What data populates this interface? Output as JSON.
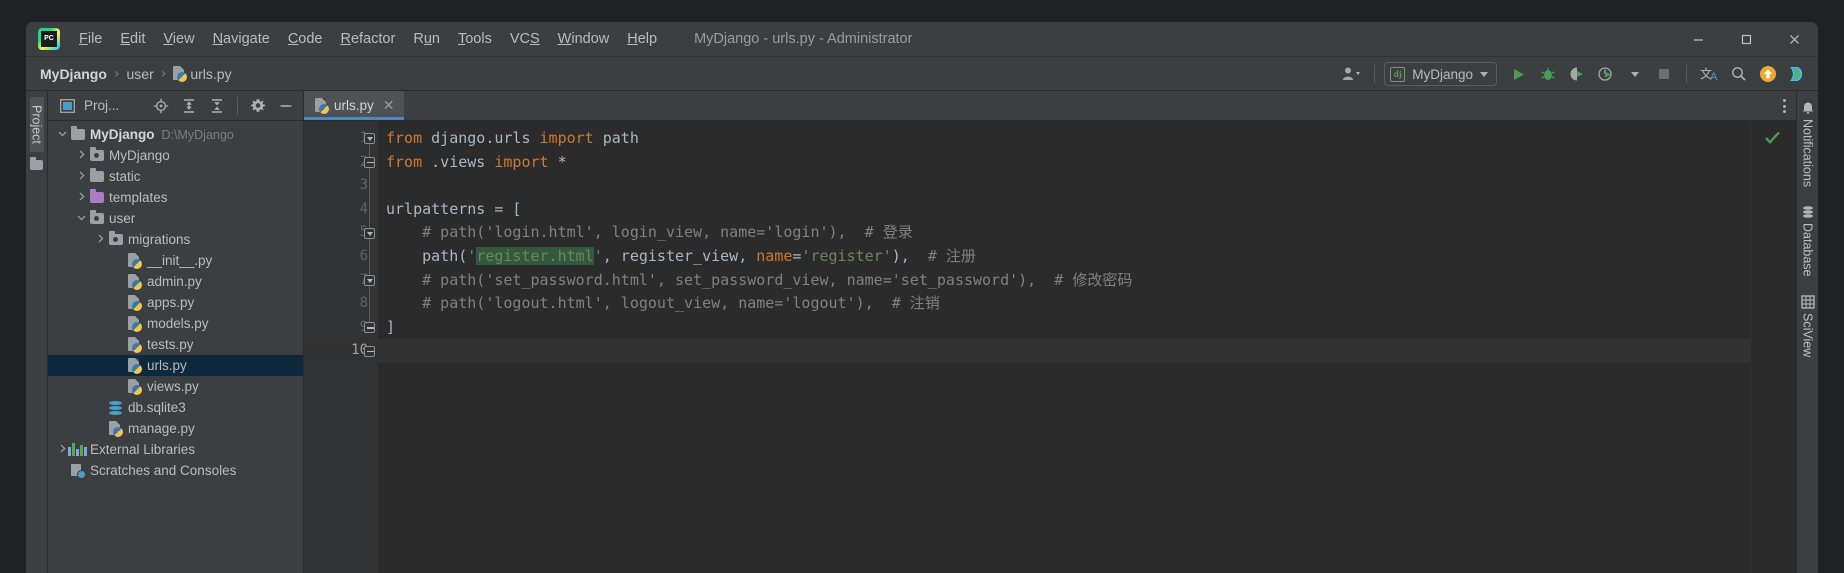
{
  "window": {
    "title": "MyDjango - urls.py - Administrator",
    "logo": "pycharm-logo",
    "minimize": "—",
    "maximize": "☐",
    "close": "✕"
  },
  "menu": {
    "items": [
      {
        "label": "File",
        "mnemonic": "F"
      },
      {
        "label": "Edit",
        "mnemonic": "E"
      },
      {
        "label": "View",
        "mnemonic": "V"
      },
      {
        "label": "Navigate",
        "mnemonic": "N"
      },
      {
        "label": "Code",
        "mnemonic": "C"
      },
      {
        "label": "Refactor",
        "mnemonic": "R"
      },
      {
        "label": "Run",
        "mnemonic": "u"
      },
      {
        "label": "Tools",
        "mnemonic": "T"
      },
      {
        "label": "VCS",
        "mnemonic": "S"
      },
      {
        "label": "Window",
        "mnemonic": "W"
      },
      {
        "label": "Help",
        "mnemonic": "H"
      }
    ]
  },
  "breadcrumb": {
    "items": [
      "MyDjango",
      "user",
      "urls.py"
    ],
    "separator": "›"
  },
  "toolbar": {
    "run_config": "MyDjango",
    "run_config_icon": "django-icon",
    "buttons": [
      {
        "name": "run-button",
        "icon": "play-icon"
      },
      {
        "name": "debug-button",
        "icon": "bug-icon"
      },
      {
        "name": "run-coverage-button",
        "icon": "coverage-icon"
      },
      {
        "name": "profile-button",
        "icon": "profiler-icon"
      },
      {
        "name": "stop-button",
        "icon": "stop-icon"
      },
      {
        "name": "translate-button",
        "icon": "translate-icon"
      },
      {
        "name": "search-everywhere-button",
        "icon": "search-icon"
      },
      {
        "name": "update-project-button",
        "icon": "arrow-up-icon"
      },
      {
        "name": "datalore-button",
        "icon": "datalore-icon"
      }
    ],
    "translate_glyph": "文A"
  },
  "left_rail": {
    "label": "Project"
  },
  "project_panel": {
    "title": "Proj...",
    "actions": [
      "locate-icon",
      "expand-all-icon",
      "collapse-all-icon",
      "settings-icon",
      "hide-icon"
    ],
    "tree": [
      {
        "label": "MyDjango",
        "sub": "D:\\MyDjango",
        "depth": 0,
        "arrow": "down",
        "icon": "folder-gray",
        "bold": true,
        "selected": false
      },
      {
        "label": "MyDjango",
        "sub": "",
        "depth": 1,
        "arrow": "right",
        "icon": "folder-module",
        "bold": false,
        "selected": false
      },
      {
        "label": "static",
        "sub": "",
        "depth": 1,
        "arrow": "right",
        "icon": "folder-gray",
        "bold": false,
        "selected": false
      },
      {
        "label": "templates",
        "sub": "",
        "depth": 1,
        "arrow": "right",
        "icon": "folder-purple",
        "bold": false,
        "selected": false
      },
      {
        "label": "user",
        "sub": "",
        "depth": 1,
        "arrow": "down",
        "icon": "folder-module",
        "bold": false,
        "selected": false
      },
      {
        "label": "migrations",
        "sub": "",
        "depth": 2,
        "arrow": "right",
        "icon": "folder-module",
        "bold": false,
        "selected": false
      },
      {
        "label": "__init__.py",
        "sub": "",
        "depth": 3,
        "arrow": "none",
        "icon": "python-file",
        "bold": false,
        "selected": false
      },
      {
        "label": "admin.py",
        "sub": "",
        "depth": 3,
        "arrow": "none",
        "icon": "python-file",
        "bold": false,
        "selected": false
      },
      {
        "label": "apps.py",
        "sub": "",
        "depth": 3,
        "arrow": "none",
        "icon": "python-file",
        "bold": false,
        "selected": false
      },
      {
        "label": "models.py",
        "sub": "",
        "depth": 3,
        "arrow": "none",
        "icon": "python-file",
        "bold": false,
        "selected": false
      },
      {
        "label": "tests.py",
        "sub": "",
        "depth": 3,
        "arrow": "none",
        "icon": "python-file",
        "bold": false,
        "selected": false
      },
      {
        "label": "urls.py",
        "sub": "",
        "depth": 3,
        "arrow": "none",
        "icon": "python-file",
        "bold": false,
        "selected": true
      },
      {
        "label": "views.py",
        "sub": "",
        "depth": 3,
        "arrow": "none",
        "icon": "python-file",
        "bold": false,
        "selected": false
      },
      {
        "label": "db.sqlite3",
        "sub": "",
        "depth": 2,
        "arrow": "none",
        "icon": "database-file",
        "bold": false,
        "selected": false
      },
      {
        "label": "manage.py",
        "sub": "",
        "depth": 2,
        "arrow": "none",
        "icon": "python-file",
        "bold": false,
        "selected": false
      },
      {
        "label": "External Libraries",
        "sub": "",
        "depth": 0,
        "arrow": "right",
        "icon": "libraries",
        "bold": false,
        "selected": false
      },
      {
        "label": "Scratches and Consoles",
        "sub": "",
        "depth": 0,
        "arrow": "none",
        "icon": "scratches",
        "bold": false,
        "selected": false
      }
    ]
  },
  "editor": {
    "tab": {
      "label": "urls.py",
      "icon": "python-file",
      "close": "✕"
    },
    "tab_menu_icon": "more-vertical-icon",
    "inspection_status": "ok-check-icon",
    "line_numbers": [
      "1",
      "2",
      "3",
      "4",
      "5",
      "6",
      "7",
      "8",
      "9",
      "10"
    ],
    "current_line": 10,
    "lines": [
      {
        "n": 1,
        "tokens": [
          {
            "t": "from",
            "c": "kw"
          },
          {
            "t": " django.urls ",
            "c": "txt"
          },
          {
            "t": "import",
            "c": "kw"
          },
          {
            "t": " path",
            "c": "txt"
          }
        ]
      },
      {
        "n": 2,
        "tokens": [
          {
            "t": "from",
            "c": "kw"
          },
          {
            "t": " .views ",
            "c": "txt"
          },
          {
            "t": "import",
            "c": "kw"
          },
          {
            "t": " *",
            "c": "txt"
          }
        ]
      },
      {
        "n": 3,
        "tokens": []
      },
      {
        "n": 4,
        "tokens": [
          {
            "t": "urlpatterns = [",
            "c": "txt"
          }
        ]
      },
      {
        "n": 5,
        "tokens": [
          {
            "t": "    # path('login.html', login_view, name='login'),  # 登录",
            "c": "cmt"
          }
        ]
      },
      {
        "n": 6,
        "tokens": [
          {
            "t": "    path(",
            "c": "txt"
          },
          {
            "t": "'",
            "c": "str"
          },
          {
            "t": "register.html",
            "c": "str hl"
          },
          {
            "t": "'",
            "c": "str"
          },
          {
            "t": ", register_view, ",
            "c": "txt"
          },
          {
            "t": "name",
            "c": "nam"
          },
          {
            "t": "=",
            "c": "txt"
          },
          {
            "t": "'register'",
            "c": "str"
          },
          {
            "t": "),  ",
            "c": "txt"
          },
          {
            "t": "# 注册",
            "c": "cmt"
          }
        ]
      },
      {
        "n": 7,
        "tokens": [
          {
            "t": "    # path('set_password.html', set_password_view, name='set_password'),  # 修改密码",
            "c": "cmt"
          }
        ]
      },
      {
        "n": 8,
        "tokens": [
          {
            "t": "    # path('logout.html', logout_view, name='logout'),  # 注销",
            "c": "cmt"
          }
        ]
      },
      {
        "n": 9,
        "tokens": [
          {
            "t": "]",
            "c": "txt"
          }
        ]
      },
      {
        "n": 10,
        "tokens": []
      }
    ]
  },
  "right_rail": {
    "items": [
      {
        "label": "Notifications",
        "icon": "bell-icon"
      },
      {
        "label": "Database",
        "icon": "database-icon"
      },
      {
        "label": "SciView",
        "icon": "grid-icon"
      }
    ]
  },
  "colors": {
    "background": "#3c3f41",
    "editor_bg": "#2b2b2b",
    "gutter_bg": "#313335",
    "keyword": "#cc7832",
    "string": "#6a8759",
    "comment": "#808080",
    "identifier": "#a9b7c6",
    "selection": "#0d293e",
    "highlight": "#32593d",
    "tab_accent": "#4a88c7",
    "ok_green": "#499c54"
  }
}
